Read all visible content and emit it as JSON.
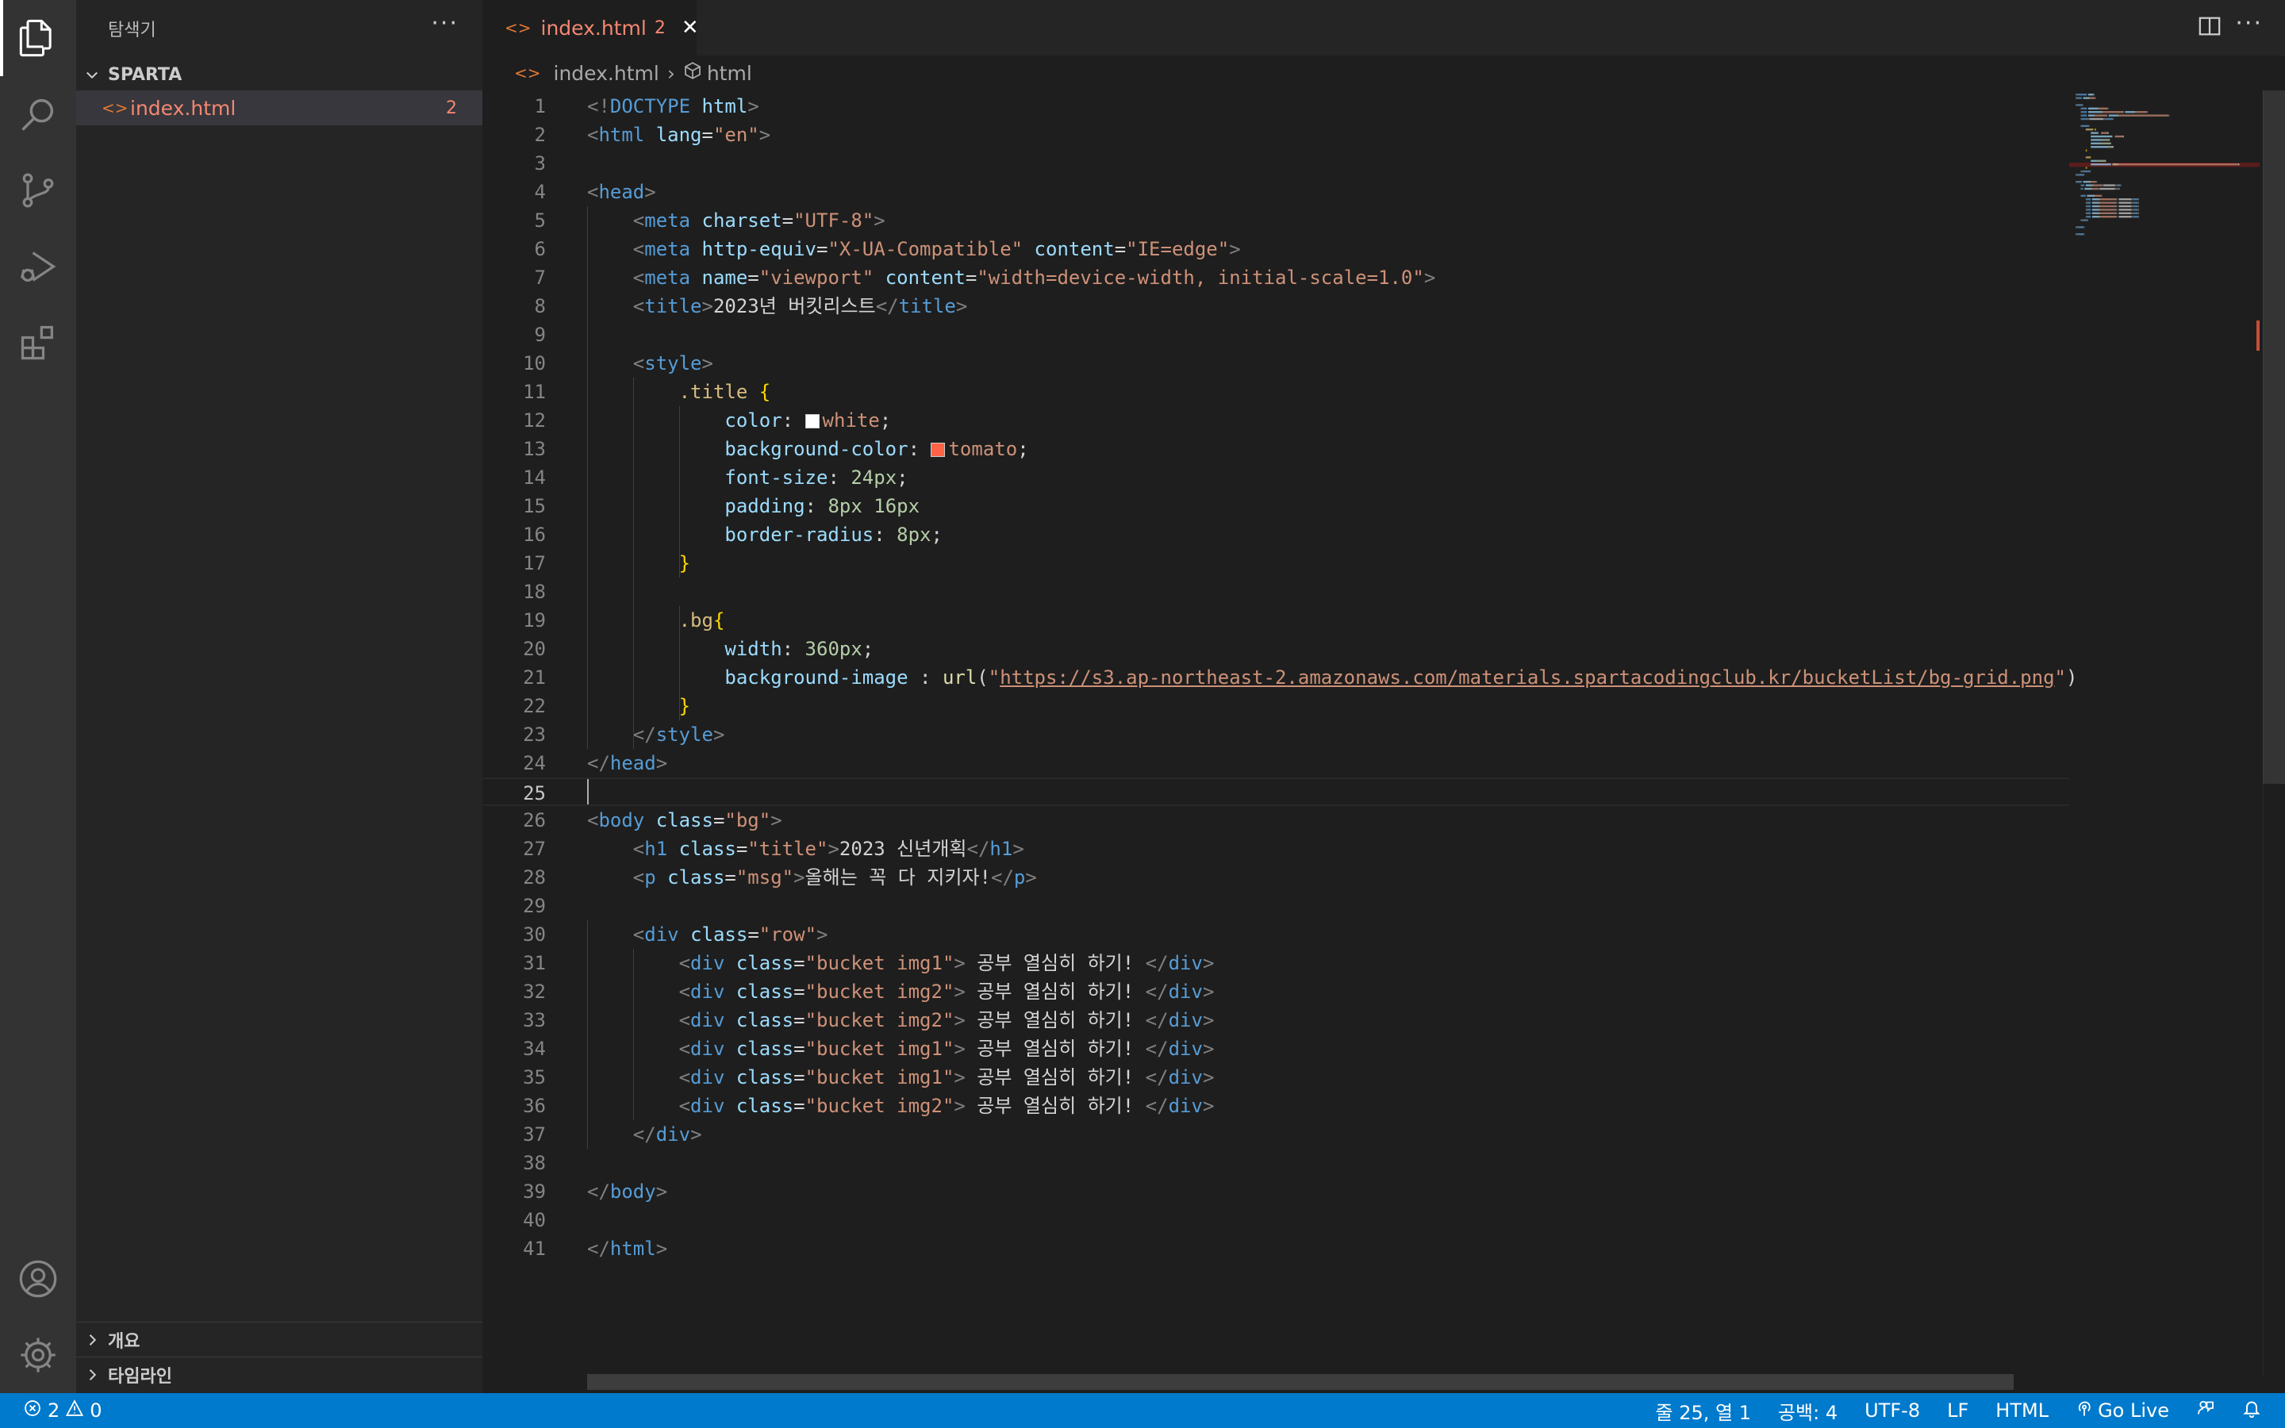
{
  "sidebar": {
    "title": "탐색기",
    "more": "···",
    "folder": "SPARTA",
    "files": [
      {
        "name": "index.html",
        "badge": "2"
      }
    ],
    "panels": [
      {
        "label": "개요"
      },
      {
        "label": "타임라인"
      }
    ]
  },
  "tabs": [
    {
      "name": "index.html",
      "badge": "2",
      "close": "✕"
    }
  ],
  "editor_actions": {
    "more": "···"
  },
  "breadcrumb": {
    "file": "index.html",
    "sep": "›",
    "node": "html"
  },
  "status": {
    "errors": "2",
    "warnings": "0",
    "position": "줄 25, 열 1",
    "spaces": "공백: 4",
    "encoding": "UTF-8",
    "eol": "LF",
    "language": "HTML",
    "golive": "Go Live"
  },
  "colors": {
    "accent": "#007acc",
    "error_file": "#f48771",
    "tomato": "#ff6347"
  },
  "icons": [
    "files-icon",
    "search-icon",
    "source-control-icon",
    "run-debug-icon",
    "extensions-icon",
    "account-icon",
    "settings-gear-icon"
  ],
  "code": {
    "cursor_line": 25,
    "lines": [
      {
        "n": "1",
        "tokens": [
          [
            "b",
            "<!"
          ],
          [
            "tag",
            "DOCTYPE"
          ],
          [
            "t",
            " "
          ],
          [
            "attr",
            "html"
          ],
          [
            "b",
            ">"
          ]
        ]
      },
      {
        "n": "2",
        "tokens": [
          [
            "b",
            "<"
          ],
          [
            "tag",
            "html"
          ],
          [
            "t",
            " "
          ],
          [
            "attr",
            "lang"
          ],
          [
            "t",
            "="
          ],
          [
            "str",
            "\"en\""
          ],
          [
            "b",
            ">"
          ]
        ]
      },
      {
        "n": "3",
        "tokens": []
      },
      {
        "n": "4",
        "tokens": [
          [
            "b",
            "<"
          ],
          [
            "tag",
            "head"
          ],
          [
            "b",
            ">"
          ]
        ]
      },
      {
        "n": "5",
        "tokens": [
          [
            "t",
            "    "
          ],
          [
            "b",
            "<"
          ],
          [
            "tag",
            "meta"
          ],
          [
            "t",
            " "
          ],
          [
            "attr",
            "charset"
          ],
          [
            "t",
            "="
          ],
          [
            "str",
            "\"UTF-8\""
          ],
          [
            "b",
            ">"
          ]
        ]
      },
      {
        "n": "6",
        "tokens": [
          [
            "t",
            "    "
          ],
          [
            "b",
            "<"
          ],
          [
            "tag",
            "meta"
          ],
          [
            "t",
            " "
          ],
          [
            "attr",
            "http-equiv"
          ],
          [
            "t",
            "="
          ],
          [
            "str",
            "\"X-UA-Compatible\""
          ],
          [
            "t",
            " "
          ],
          [
            "attr",
            "content"
          ],
          [
            "t",
            "="
          ],
          [
            "str",
            "\"IE=edge\""
          ],
          [
            "b",
            ">"
          ]
        ]
      },
      {
        "n": "7",
        "tokens": [
          [
            "t",
            "    "
          ],
          [
            "b",
            "<"
          ],
          [
            "tag",
            "meta"
          ],
          [
            "t",
            " "
          ],
          [
            "attr",
            "name"
          ],
          [
            "t",
            "="
          ],
          [
            "str",
            "\"viewport\""
          ],
          [
            "t",
            " "
          ],
          [
            "attr",
            "content"
          ],
          [
            "t",
            "="
          ],
          [
            "str",
            "\"width=device-width, initial-scale=1.0\""
          ],
          [
            "b",
            ">"
          ]
        ]
      },
      {
        "n": "8",
        "tokens": [
          [
            "t",
            "    "
          ],
          [
            "b",
            "<"
          ],
          [
            "tag",
            "title"
          ],
          [
            "b",
            ">"
          ],
          [
            "t",
            "2023년 버킷리스트"
          ],
          [
            "b",
            "</"
          ],
          [
            "tag",
            "title"
          ],
          [
            "b",
            ">"
          ]
        ]
      },
      {
        "n": "9",
        "tokens": []
      },
      {
        "n": "10",
        "tokens": [
          [
            "t",
            "    "
          ],
          [
            "b",
            "<"
          ],
          [
            "tag",
            "style"
          ],
          [
            "b",
            ">"
          ]
        ]
      },
      {
        "n": "11",
        "tokens": [
          [
            "t",
            "        "
          ],
          [
            "sel",
            ".title"
          ],
          [
            "t",
            " "
          ],
          [
            "brace",
            "{"
          ]
        ]
      },
      {
        "n": "12",
        "tokens": [
          [
            "t",
            "            "
          ],
          [
            "prop",
            "color"
          ],
          [
            "t",
            ": "
          ],
          [
            "swatch",
            "#ffffff"
          ],
          [
            "str",
            "white"
          ],
          [
            "t",
            ";"
          ]
        ]
      },
      {
        "n": "13",
        "tokens": [
          [
            "t",
            "            "
          ],
          [
            "prop",
            "background-color"
          ],
          [
            "t",
            ": "
          ],
          [
            "swatch",
            "#ff6347"
          ],
          [
            "str",
            "tomato"
          ],
          [
            "t",
            ";"
          ]
        ]
      },
      {
        "n": "14",
        "tokens": [
          [
            "t",
            "            "
          ],
          [
            "prop",
            "font-size"
          ],
          [
            "t",
            ": "
          ],
          [
            "num",
            "24px"
          ],
          [
            "t",
            ";"
          ]
        ]
      },
      {
        "n": "15",
        "tokens": [
          [
            "t",
            "            "
          ],
          [
            "prop",
            "padding"
          ],
          [
            "t",
            ": "
          ],
          [
            "num",
            "8px 16px"
          ]
        ]
      },
      {
        "n": "16",
        "tokens": [
          [
            "t",
            "            "
          ],
          [
            "prop",
            "border-radius"
          ],
          [
            "t",
            ": "
          ],
          [
            "num",
            "8px"
          ],
          [
            "t",
            ";"
          ]
        ]
      },
      {
        "n": "17",
        "tokens": [
          [
            "t",
            "        "
          ],
          [
            "brace",
            "}"
          ]
        ]
      },
      {
        "n": "18",
        "tokens": []
      },
      {
        "n": "19",
        "tokens": [
          [
            "t",
            "        "
          ],
          [
            "sel",
            ".bg"
          ],
          [
            "brace",
            "{"
          ]
        ]
      },
      {
        "n": "20",
        "tokens": [
          [
            "t",
            "            "
          ],
          [
            "prop",
            "width"
          ],
          [
            "t",
            ": "
          ],
          [
            "num",
            "360px"
          ],
          [
            "t",
            ";"
          ]
        ]
      },
      {
        "n": "21",
        "tokens": [
          [
            "t",
            "            "
          ],
          [
            "prop",
            "background-image"
          ],
          [
            "t",
            " : "
          ],
          [
            "fn",
            "url"
          ],
          [
            "t",
            "("
          ],
          [
            "str",
            "\""
          ],
          [
            "url",
            "https://s3.ap-northeast-2.amazonaws.com/materials.spartacodingclub.kr/bucketList/bg-grid.png"
          ],
          [
            "str",
            "\""
          ],
          [
            "t",
            ")"
          ]
        ]
      },
      {
        "n": "22",
        "tokens": [
          [
            "t",
            "        "
          ],
          [
            "brace",
            "}"
          ]
        ]
      },
      {
        "n": "23",
        "tokens": [
          [
            "t",
            "    "
          ],
          [
            "b",
            "</"
          ],
          [
            "tag",
            "style"
          ],
          [
            "b",
            ">"
          ]
        ]
      },
      {
        "n": "24",
        "tokens": [
          [
            "b",
            "</"
          ],
          [
            "tag",
            "head"
          ],
          [
            "b",
            ">"
          ]
        ]
      },
      {
        "n": "25",
        "tokens": []
      },
      {
        "n": "26",
        "tokens": [
          [
            "b",
            "<"
          ],
          [
            "tag",
            "body"
          ],
          [
            "t",
            " "
          ],
          [
            "attr",
            "class"
          ],
          [
            "t",
            "="
          ],
          [
            "str",
            "\"bg\""
          ],
          [
            "b",
            ">"
          ]
        ]
      },
      {
        "n": "27",
        "tokens": [
          [
            "t",
            "    "
          ],
          [
            "b",
            "<"
          ],
          [
            "tag",
            "h1"
          ],
          [
            "t",
            " "
          ],
          [
            "attr",
            "class"
          ],
          [
            "t",
            "="
          ],
          [
            "str",
            "\"title\""
          ],
          [
            "b",
            ">"
          ],
          [
            "t",
            "2023 신년개획"
          ],
          [
            "b",
            "</"
          ],
          [
            "tag",
            "h1"
          ],
          [
            "b",
            ">"
          ]
        ]
      },
      {
        "n": "28",
        "tokens": [
          [
            "t",
            "    "
          ],
          [
            "b",
            "<"
          ],
          [
            "tag",
            "p"
          ],
          [
            "t",
            " "
          ],
          [
            "attr",
            "class"
          ],
          [
            "t",
            "="
          ],
          [
            "str",
            "\"msg\""
          ],
          [
            "b",
            ">"
          ],
          [
            "t",
            "올해는 꼭 다 지키자!"
          ],
          [
            "b",
            "</"
          ],
          [
            "tag",
            "p"
          ],
          [
            "b",
            ">"
          ]
        ]
      },
      {
        "n": "29",
        "tokens": []
      },
      {
        "n": "30",
        "tokens": [
          [
            "t",
            "    "
          ],
          [
            "b",
            "<"
          ],
          [
            "tag",
            "div"
          ],
          [
            "t",
            " "
          ],
          [
            "attr",
            "class"
          ],
          [
            "t",
            "="
          ],
          [
            "str",
            "\"row\""
          ],
          [
            "b",
            ">"
          ]
        ]
      },
      {
        "n": "31",
        "tokens": [
          [
            "t",
            "        "
          ],
          [
            "b",
            "<"
          ],
          [
            "tag",
            "div"
          ],
          [
            "t",
            " "
          ],
          [
            "attr",
            "class"
          ],
          [
            "t",
            "="
          ],
          [
            "str",
            "\"bucket img1\""
          ],
          [
            "b",
            ">"
          ],
          [
            "t",
            " 공부 열심히 하기! "
          ],
          [
            "b",
            "</"
          ],
          [
            "tag",
            "div"
          ],
          [
            "b",
            ">"
          ]
        ]
      },
      {
        "n": "32",
        "tokens": [
          [
            "t",
            "        "
          ],
          [
            "b",
            "<"
          ],
          [
            "tag",
            "div"
          ],
          [
            "t",
            " "
          ],
          [
            "attr",
            "class"
          ],
          [
            "t",
            "="
          ],
          [
            "str",
            "\"bucket img2\""
          ],
          [
            "b",
            ">"
          ],
          [
            "t",
            " 공부 열심히 하기! "
          ],
          [
            "b",
            "</"
          ],
          [
            "tag",
            "div"
          ],
          [
            "b",
            ">"
          ]
        ]
      },
      {
        "n": "33",
        "tokens": [
          [
            "t",
            "        "
          ],
          [
            "b",
            "<"
          ],
          [
            "tag",
            "div"
          ],
          [
            "t",
            " "
          ],
          [
            "attr",
            "class"
          ],
          [
            "t",
            "="
          ],
          [
            "str",
            "\"bucket img2\""
          ],
          [
            "b",
            ">"
          ],
          [
            "t",
            " 공부 열심히 하기! "
          ],
          [
            "b",
            "</"
          ],
          [
            "tag",
            "div"
          ],
          [
            "b",
            ">"
          ]
        ]
      },
      {
        "n": "34",
        "tokens": [
          [
            "t",
            "        "
          ],
          [
            "b",
            "<"
          ],
          [
            "tag",
            "div"
          ],
          [
            "t",
            " "
          ],
          [
            "attr",
            "class"
          ],
          [
            "t",
            "="
          ],
          [
            "str",
            "\"bucket img1\""
          ],
          [
            "b",
            ">"
          ],
          [
            "t",
            " 공부 열심히 하기! "
          ],
          [
            "b",
            "</"
          ],
          [
            "tag",
            "div"
          ],
          [
            "b",
            ">"
          ]
        ]
      },
      {
        "n": "35",
        "tokens": [
          [
            "t",
            "        "
          ],
          [
            "b",
            "<"
          ],
          [
            "tag",
            "div"
          ],
          [
            "t",
            " "
          ],
          [
            "attr",
            "class"
          ],
          [
            "t",
            "="
          ],
          [
            "str",
            "\"bucket img1\""
          ],
          [
            "b",
            ">"
          ],
          [
            "t",
            " 공부 열심히 하기! "
          ],
          [
            "b",
            "</"
          ],
          [
            "tag",
            "div"
          ],
          [
            "b",
            ">"
          ]
        ]
      },
      {
        "n": "36",
        "tokens": [
          [
            "t",
            "        "
          ],
          [
            "b",
            "<"
          ],
          [
            "tag",
            "div"
          ],
          [
            "t",
            " "
          ],
          [
            "attr",
            "class"
          ],
          [
            "t",
            "="
          ],
          [
            "str",
            "\"bucket img2\""
          ],
          [
            "b",
            ">"
          ],
          [
            "t",
            " 공부 열심히 하기! "
          ],
          [
            "b",
            "</"
          ],
          [
            "tag",
            "div"
          ],
          [
            "b",
            ">"
          ]
        ]
      },
      {
        "n": "37",
        "tokens": [
          [
            "t",
            "    "
          ],
          [
            "b",
            "</"
          ],
          [
            "tag",
            "div"
          ],
          [
            "b",
            ">"
          ]
        ]
      },
      {
        "n": "38",
        "tokens": []
      },
      {
        "n": "39",
        "tokens": [
          [
            "b",
            "</"
          ],
          [
            "tag",
            "body"
          ],
          [
            "b",
            ">"
          ]
        ]
      },
      {
        "n": "40",
        "tokens": []
      },
      {
        "n": "41",
        "tokens": [
          [
            "b",
            "</"
          ],
          [
            "tag",
            "html"
          ],
          [
            "b",
            ">"
          ]
        ]
      }
    ]
  }
}
